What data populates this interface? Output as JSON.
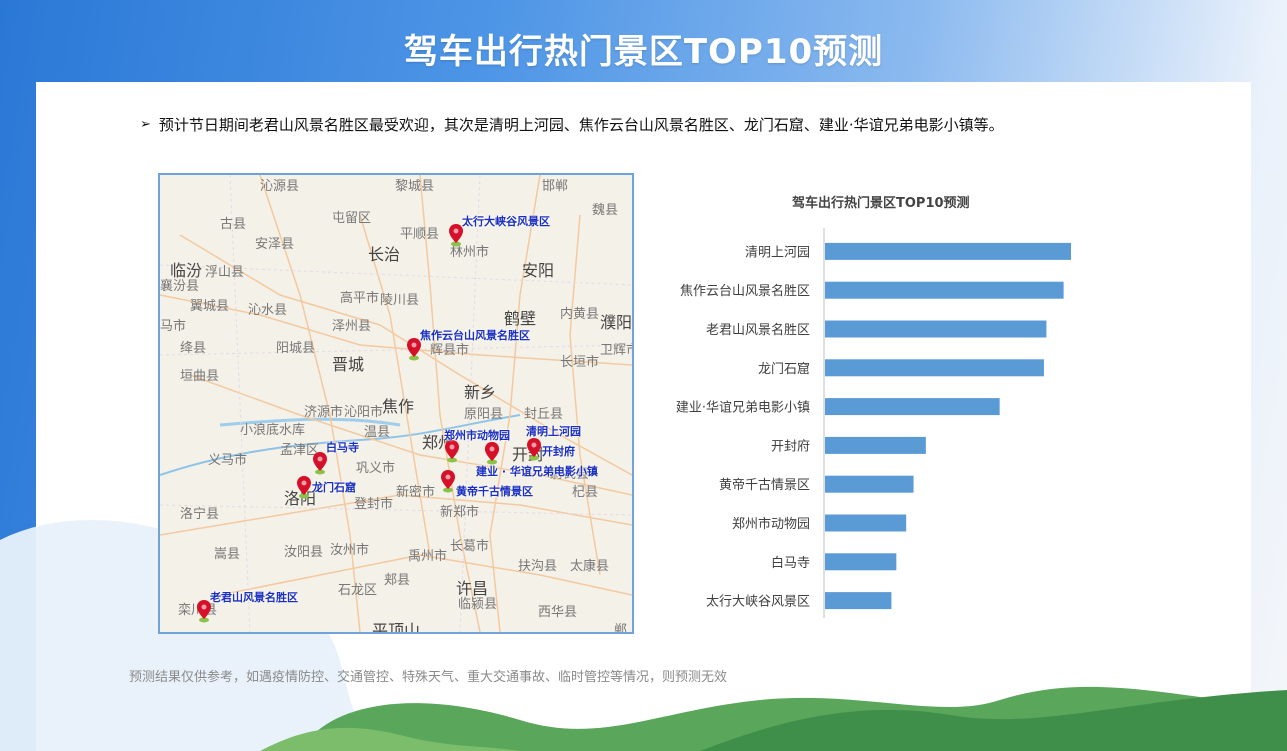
{
  "header": {
    "title": "驾车出行热门景区TOP10预测"
  },
  "summary": {
    "bullet": "➢",
    "text": "预计节日期间老君山风景名胜区最受欢迎，其次是清明上河园、焦作云台山风景名胜区、龙门石窟、建业·华谊兄弟电影小镇等。"
  },
  "map": {
    "cities": [
      "沁源县",
      "黎城县",
      "邯郸",
      "古县",
      "屯留区",
      "安泽县",
      "长治",
      "平顺县",
      "魏县",
      "林州市",
      "临汾",
      "浮山县",
      "安阳",
      "襄汾县",
      "翼城县",
      "沁水县",
      "高平市",
      "陵川县",
      "鹤壁",
      "内黄县",
      "马市",
      "濮阳",
      "绛县",
      "阳城县",
      "泽州县",
      "晋城",
      "辉县市",
      "卫辉市",
      "垣曲县",
      "长垣市",
      "焦作",
      "新乡",
      "济源市",
      "沁阳市",
      "原阳县",
      "封丘县",
      "小浪底水库",
      "孟津区",
      "温县",
      "义马市",
      "郑州",
      "开封",
      "洛阳",
      "巩义市",
      "新密市",
      "尉氏县",
      "杞县",
      "洛宁县",
      "登封市",
      "新郑市",
      "嵩县",
      "汝阳县",
      "汝州市",
      "禹州市",
      "长葛市",
      "扶沟县",
      "太康县",
      "郏县",
      "石龙区",
      "许昌",
      "平顶山",
      "临颍县",
      "西华县",
      "栾川县",
      "郸"
    ],
    "markers": [
      {
        "name": "太行大峡谷风景区"
      },
      {
        "name": "焦作云台山风景名胜区"
      },
      {
        "name": "郑州市动物园"
      },
      {
        "name": "清明上河园"
      },
      {
        "name": "开封府"
      },
      {
        "name": "白马寺"
      },
      {
        "name": "建业 · 华谊兄弟电影小镇"
      },
      {
        "name": "龙门石窟"
      },
      {
        "name": "黄帝千古情景区"
      },
      {
        "name": "老君山风景名胜区"
      }
    ],
    "marker_color": "#d7102a",
    "label_color": "#1a2fbf"
  },
  "chart_data": {
    "type": "bar",
    "orientation": "horizontal",
    "title": "驾车出行热门景区TOP10预测",
    "categories": [
      "清明上河园",
      "焦作云台山风景名胜区",
      "老君山风景名胜区",
      "龙门石窟",
      "建业·华谊兄弟电影小镇",
      "开封府",
      "黄帝千古情景区",
      "郑州市动物园",
      "白马寺",
      "太行大峡谷风景区"
    ],
    "values": [
      100,
      97,
      90,
      89,
      71,
      41,
      36,
      33,
      29,
      27
    ],
    "xlabel": "",
    "ylabel": "",
    "xlim": [
      0,
      100
    ],
    "grid": false,
    "bar_color": "#5b9bd5"
  },
  "footer": {
    "note": "预测结果仅供参考，如遇疫情防控、交通管控、特殊天气、重大交通事故、临时管控等情况，则预测无效"
  }
}
